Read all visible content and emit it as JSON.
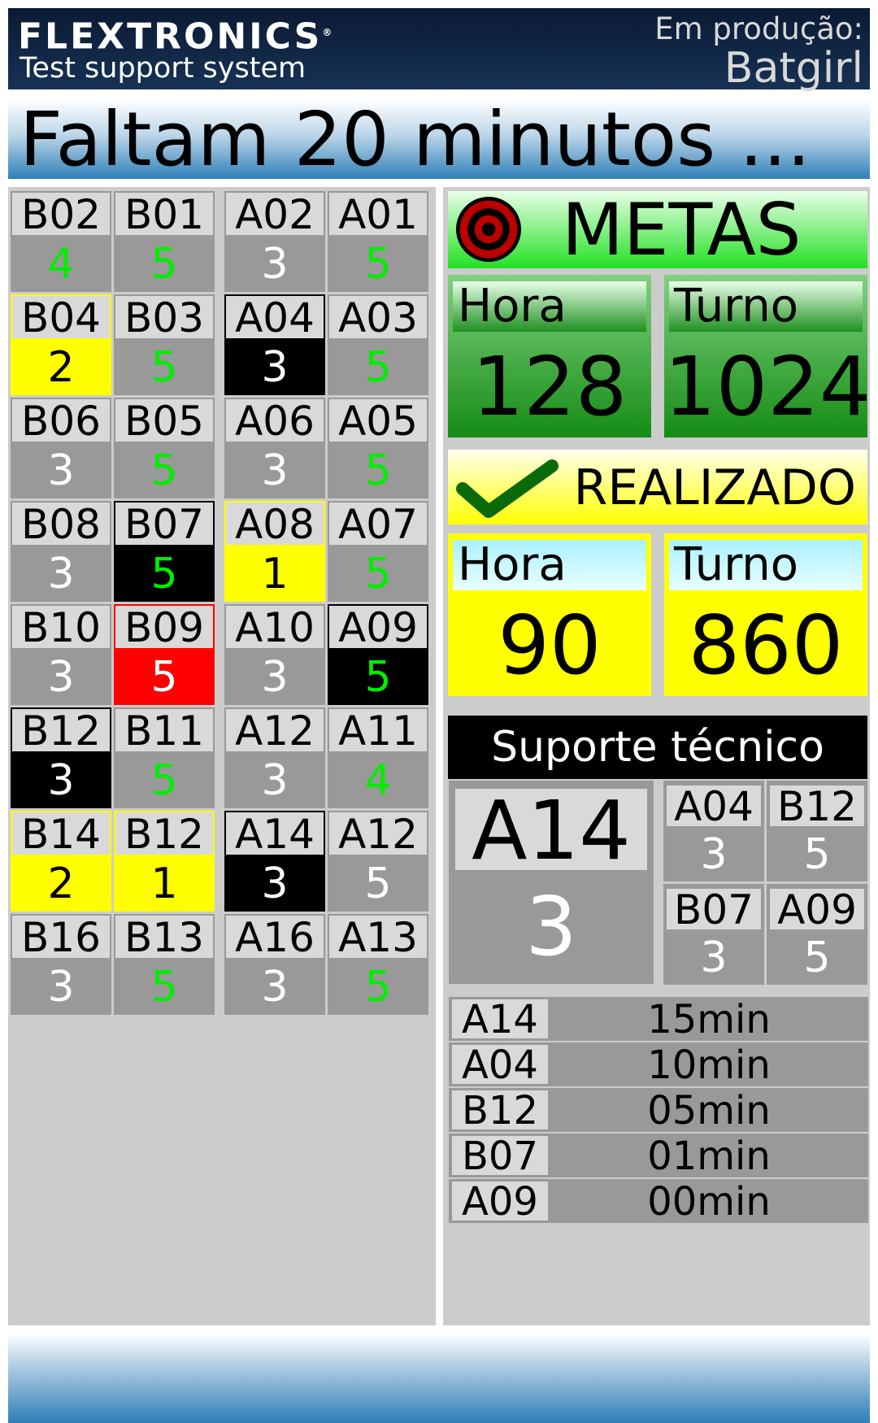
{
  "header": {
    "brand": "FLEXTRONICS",
    "brand_mark": "®",
    "subtitle": "Test support system",
    "production_label": "Em produção:",
    "production_name": "Batgirl"
  },
  "banner": {
    "text": "Faltam 20 minutos ..."
  },
  "grid": [
    {
      "label": "B02",
      "value": "4",
      "state": "green"
    },
    {
      "label": "B01",
      "value": "5",
      "state": "green"
    },
    {
      "label": "A02",
      "value": "3",
      "state": "white"
    },
    {
      "label": "A01",
      "value": "5",
      "state": "green"
    },
    {
      "label": "B04",
      "value": "2",
      "state": "yellow"
    },
    {
      "label": "B03",
      "value": "5",
      "state": "green"
    },
    {
      "label": "A04",
      "value": "3",
      "state": "black"
    },
    {
      "label": "A03",
      "value": "5",
      "state": "green"
    },
    {
      "label": "B06",
      "value": "3",
      "state": "white"
    },
    {
      "label": "B05",
      "value": "5",
      "state": "green"
    },
    {
      "label": "A06",
      "value": "3",
      "state": "white"
    },
    {
      "label": "A05",
      "value": "5",
      "state": "green"
    },
    {
      "label": "B08",
      "value": "3",
      "state": "white"
    },
    {
      "label": "B07",
      "value": "5",
      "state": "black-green"
    },
    {
      "label": "A08",
      "value": "1",
      "state": "yellow"
    },
    {
      "label": "A07",
      "value": "5",
      "state": "green"
    },
    {
      "label": "B10",
      "value": "3",
      "state": "white"
    },
    {
      "label": "B09",
      "value": "5",
      "state": "red"
    },
    {
      "label": "A10",
      "value": "3",
      "state": "white"
    },
    {
      "label": "A09",
      "value": "5",
      "state": "black-green"
    },
    {
      "label": "B12",
      "value": "3",
      "state": "black"
    },
    {
      "label": "B11",
      "value": "5",
      "state": "green"
    },
    {
      "label": "A12",
      "value": "3",
      "state": "white"
    },
    {
      "label": "A11",
      "value": "4",
      "state": "green"
    },
    {
      "label": "B14",
      "value": "2",
      "state": "yellow"
    },
    {
      "label": "B12",
      "value": "1",
      "state": "yellow"
    },
    {
      "label": "A14",
      "value": "3",
      "state": "black"
    },
    {
      "label": "A12",
      "value": "5",
      "state": "white"
    },
    {
      "label": "B16",
      "value": "3",
      "state": "white"
    },
    {
      "label": "B13",
      "value": "5",
      "state": "green"
    },
    {
      "label": "A16",
      "value": "3",
      "state": "white"
    },
    {
      "label": "A13",
      "value": "5",
      "state": "green"
    }
  ],
  "metas": {
    "title": "METAS",
    "icon": "target-icon",
    "hora_label": "Hora",
    "hora_value": "128",
    "turno_label": "Turno",
    "turno_value": "1024"
  },
  "realizado": {
    "title": "REALIZADO",
    "icon": "check-icon",
    "hora_label": "Hora",
    "hora_value": "90",
    "turno_label": "Turno",
    "turno_value": "860"
  },
  "suporte": {
    "title": "Suporte técnico",
    "main": {
      "label": "A14",
      "value": "3"
    },
    "cells": [
      {
        "label": "A04",
        "value": "3"
      },
      {
        "label": "B12",
        "value": "5"
      },
      {
        "label": "B07",
        "value": "3"
      },
      {
        "label": "A09",
        "value": "5"
      }
    ],
    "times": [
      {
        "id": "A14",
        "time": "15min"
      },
      {
        "id": "A04",
        "time": "10min"
      },
      {
        "id": "B12",
        "time": "05min"
      },
      {
        "id": "B07",
        "time": "01min"
      },
      {
        "id": "A09",
        "time": "00min"
      }
    ]
  },
  "colors": {
    "header_bg": "#0a1a33",
    "ok_green": "#00ee00",
    "warning_yellow": "#ffff00",
    "alarm_red": "#ff0000",
    "panel_gray": "#cccccc",
    "cell_gray": "#999999"
  }
}
